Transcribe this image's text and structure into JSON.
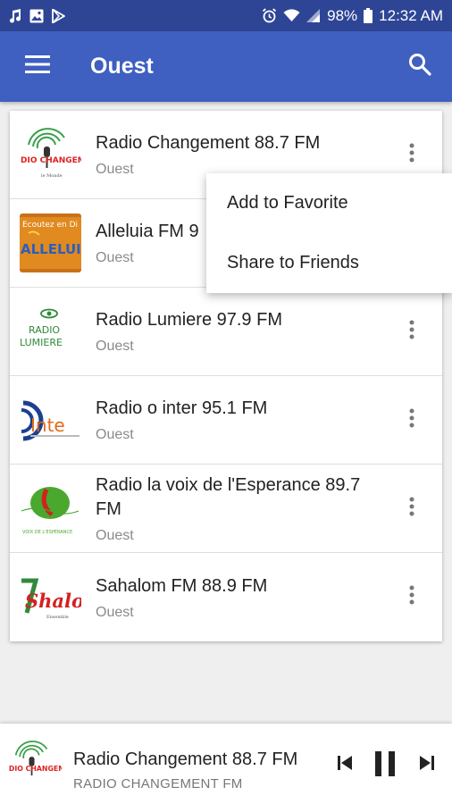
{
  "status_bar": {
    "battery": "98%",
    "time": "12:32 AM",
    "icons": [
      "music-note-icon",
      "gallery-icon",
      "play-store-icon",
      "alarm-icon",
      "wifi-icon",
      "signal-icon",
      "battery-icon"
    ]
  },
  "app_bar": {
    "title": "Ouest",
    "menu_icon": "hamburger-menu-icon",
    "search_icon": "search-icon",
    "color": "#3f5fc1"
  },
  "stations": [
    {
      "name": "Radio Changement 88.7 FM",
      "region": "Ouest",
      "logo_text": "DIO CHANGEME"
    },
    {
      "name": "Alleluia FM 9",
      "region": "Ouest",
      "logo_text": "ALLELUIA",
      "logo_top": "Ecoutez en Di"
    },
    {
      "name": "Radio Lumiere 97.9 FM",
      "region": "Ouest",
      "logo_text": "RADIO",
      "logo_text2": "LUMIERE"
    },
    {
      "name": "Radio o inter 95.1 FM",
      "region": "Ouest",
      "logo_text": "Inte"
    },
    {
      "name": "Radio la voix de l'Esperance 89.7 FM",
      "region": "Ouest",
      "logo_text": "VOIX DE L'ESPERANCE"
    },
    {
      "name": "Sahalom FM 88.9 FM",
      "region": "Ouest",
      "logo_text": "Shalon"
    }
  ],
  "popup_menu": {
    "items": [
      "Add to Favorite",
      "Share to Friends"
    ]
  },
  "player": {
    "title": "Radio Changement 88.7 FM",
    "subtitle": "RADIO CHANGEMENT FM",
    "controls": [
      "skip-previous-icon",
      "pause-icon",
      "skip-next-icon"
    ]
  }
}
